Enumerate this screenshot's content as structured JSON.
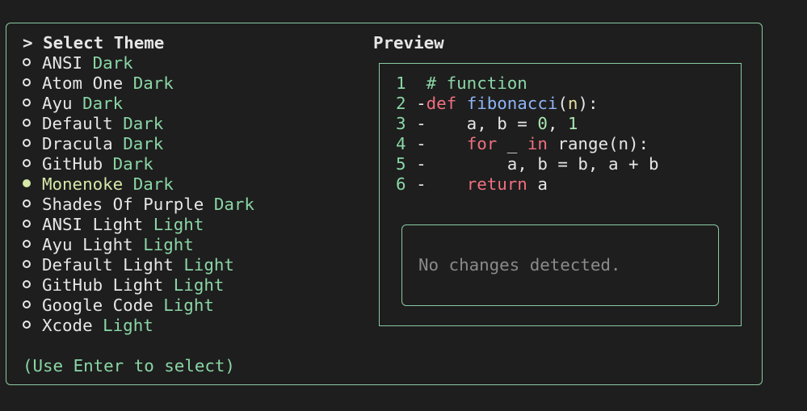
{
  "theme_dialog": {
    "prompt": ">",
    "title": "Select Theme",
    "themes": [
      {
        "name": "ANSI",
        "kind": "Dark",
        "selected": false
      },
      {
        "name": "Atom One",
        "kind": "Dark",
        "selected": false
      },
      {
        "name": "Ayu",
        "kind": "Dark",
        "selected": false
      },
      {
        "name": "Default",
        "kind": "Dark",
        "selected": false
      },
      {
        "name": "Dracula",
        "kind": "Dark",
        "selected": false
      },
      {
        "name": "GitHub",
        "kind": "Dark",
        "selected": false
      },
      {
        "name": "Monenoke",
        "kind": "Dark",
        "selected": true
      },
      {
        "name": "Shades Of Purple",
        "kind": "Dark",
        "selected": false
      },
      {
        "name": "ANSI Light",
        "kind": "Light",
        "selected": false
      },
      {
        "name": "Ayu Light",
        "kind": "Light",
        "selected": false
      },
      {
        "name": "Default Light",
        "kind": "Light",
        "selected": false
      },
      {
        "name": "GitHub Light",
        "kind": "Light",
        "selected": false
      },
      {
        "name": "Google Code",
        "kind": "Light",
        "selected": false
      },
      {
        "name": "Xcode",
        "kind": "Light",
        "selected": false
      }
    ],
    "hint": "(Use Enter to select)"
  },
  "preview": {
    "title": "Preview",
    "code_lines": [
      {
        "num": "1",
        "marker": " ",
        "tokens": [
          {
            "t": "# function",
            "c": "cm"
          }
        ]
      },
      {
        "num": "2",
        "marker": "-",
        "tokens": [
          {
            "t": "def",
            "c": "kw"
          },
          {
            "t": " ",
            "c": "df"
          },
          {
            "t": "fibonacci",
            "c": "fn"
          },
          {
            "t": "(",
            "c": "df"
          },
          {
            "t": "n",
            "c": "par"
          },
          {
            "t": "):",
            "c": "df"
          }
        ]
      },
      {
        "num": "3",
        "marker": "-",
        "tokens": [
          {
            "t": "    a, b = ",
            "c": "df"
          },
          {
            "t": "0",
            "c": "num"
          },
          {
            "t": ", ",
            "c": "df"
          },
          {
            "t": "1",
            "c": "num"
          }
        ]
      },
      {
        "num": "4",
        "marker": "-",
        "tokens": [
          {
            "t": "    ",
            "c": "df"
          },
          {
            "t": "for",
            "c": "kw"
          },
          {
            "t": " _ ",
            "c": "df"
          },
          {
            "t": "in",
            "c": "kw"
          },
          {
            "t": " range(n):",
            "c": "df"
          }
        ]
      },
      {
        "num": "5",
        "marker": "-",
        "tokens": [
          {
            "t": "        a, b = b, a + b",
            "c": "df"
          }
        ]
      },
      {
        "num": "6",
        "marker": "-",
        "tokens": [
          {
            "t": "    ",
            "c": "df"
          },
          {
            "t": "return",
            "c": "kw"
          },
          {
            "t": " a",
            "c": "df"
          }
        ]
      }
    ],
    "diff_message": "No changes detected."
  },
  "colors": {
    "background": "#1e1e1e",
    "border": "#8ac9a4",
    "accent": "#8ad6a6",
    "selected": "#d5e8a8",
    "keyword": "#ef6f7f",
    "function": "#8fb3f5"
  }
}
